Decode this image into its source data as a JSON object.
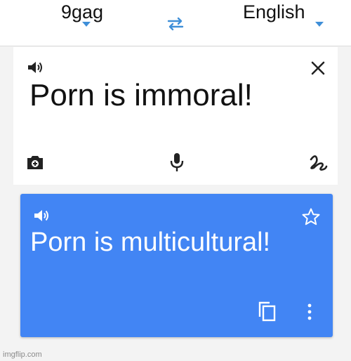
{
  "language_bar": {
    "source_language": "9gag",
    "target_language": "English",
    "swap_icon": "swap-arrows-icon",
    "caret_color": "#3f8fd8"
  },
  "input": {
    "text": "Porn is immoral!",
    "icons": [
      "speaker-icon",
      "close-icon",
      "camera-icon",
      "microphone-icon",
      "handwriting-icon"
    ]
  },
  "output": {
    "text": "Porn is multicultural!",
    "background_color": "#4285f4",
    "icons": [
      "speaker-icon",
      "star-icon",
      "copy-icon",
      "more-vertical-icon"
    ]
  },
  "watermark": "imgflip.com"
}
